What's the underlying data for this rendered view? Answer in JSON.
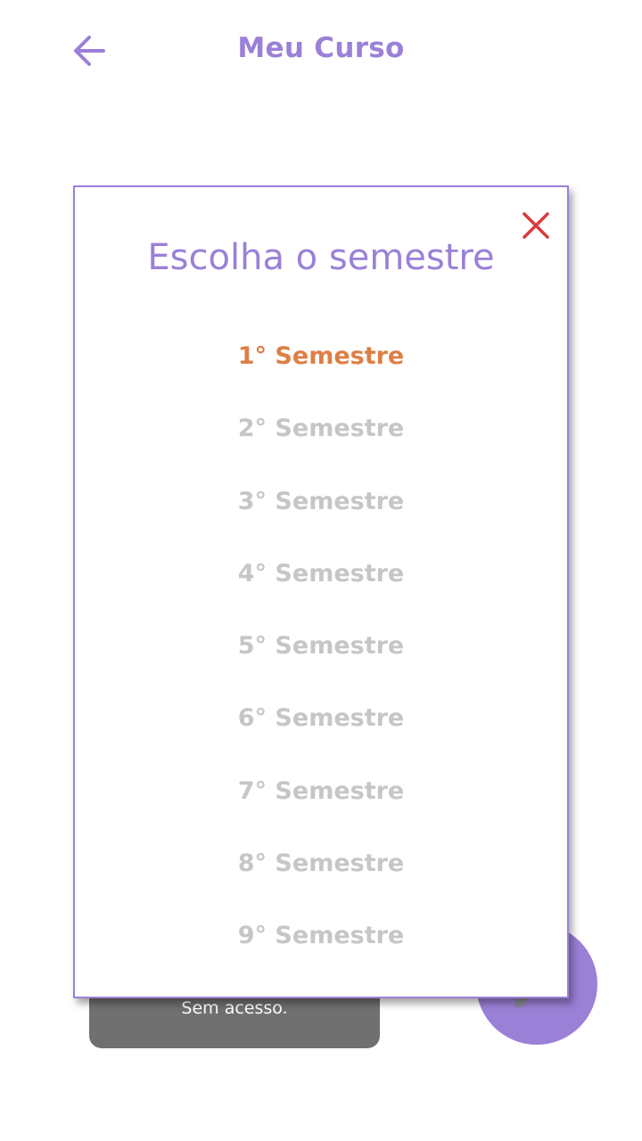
{
  "header": {
    "title": "Meu Curso",
    "back_icon": "arrow-left-icon"
  },
  "colors": {
    "primary": "#9b80d7",
    "active_item": "#dd7f45",
    "inactive_item": "#c6c6c6",
    "close": "#d93a3a",
    "toast_bg": "#707070"
  },
  "modal": {
    "title": "Escolha o semestre",
    "close_icon": "close-icon",
    "items": [
      {
        "label": "1° Semestre",
        "selected": true
      },
      {
        "label": "2° Semestre",
        "selected": false
      },
      {
        "label": "3° Semestre",
        "selected": false
      },
      {
        "label": "4° Semestre",
        "selected": false
      },
      {
        "label": "5° Semestre",
        "selected": false
      },
      {
        "label": "6° Semestre",
        "selected": false
      },
      {
        "label": "7° Semestre",
        "selected": false
      },
      {
        "label": "8° Semestre",
        "selected": false
      },
      {
        "label": "9° Semestre",
        "selected": false
      }
    ]
  },
  "background": {
    "toast_text": "Sem acesso.",
    "fab_icon": "edit-icon"
  }
}
